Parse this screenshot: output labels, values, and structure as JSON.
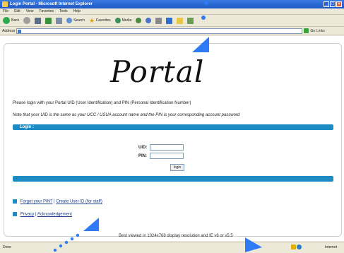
{
  "window": {
    "title": "Login      Portal - Microsoft Internet Explorer"
  },
  "menu": [
    "File",
    "Edit",
    "View",
    "Favorites",
    "Tools",
    "Help"
  ],
  "toolbar": {
    "back": "Back",
    "search": "Search",
    "favorites": "Favorites",
    "media": "Media"
  },
  "address": {
    "label": "Address",
    "go": "Go",
    "links": "Links"
  },
  "page": {
    "logo_text": "Portal",
    "intro": "Please login with your      Portal UID (User Identification) and PIN (Personal Identification Number)",
    "note": "Note that your UID is the same as your    UCC /    USUA account name and the PIN is your corresponding account password",
    "login_header": "Login :",
    "uid_label": "UID:",
    "pin_label": "PIN:",
    "login_button": "login",
    "link1a": "Forgot your PIN?",
    "sep": " | ",
    "link1b": "Create User ID (for staff)",
    "link2a": "Privacy",
    "link2b": "Acknowledgement",
    "best_viewed": "Best viewed in 1024x768 display resolution and IE v6 or v5.5"
  },
  "status": {
    "left": "Done",
    "zone": "Internet"
  },
  "colors": {
    "accent": "#1D8CC4",
    "annotation": "#2F7BF6"
  }
}
